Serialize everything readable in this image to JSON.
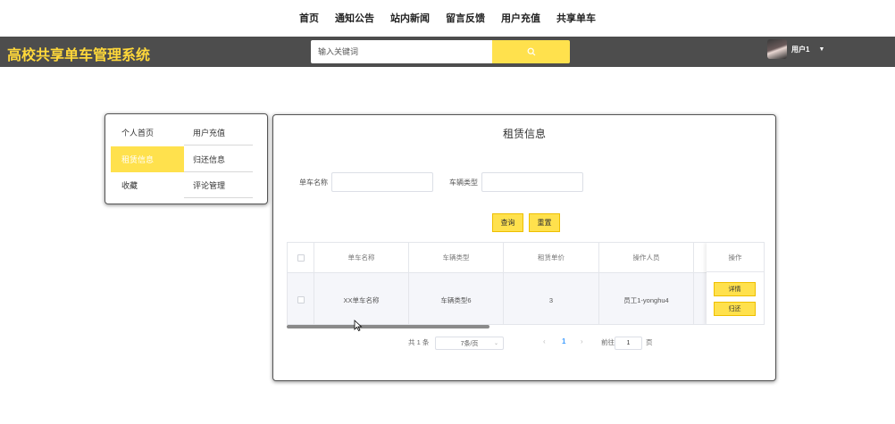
{
  "topnav": [
    "首页",
    "通知公告",
    "站内新闻",
    "留言反馈",
    "用户充值",
    "共享单车"
  ],
  "header": {
    "title": "高校共享单车管理系统",
    "search_placeholder": "输入关键词",
    "user_name": "用户1"
  },
  "sidebar": {
    "items": [
      {
        "label": "个人首页"
      },
      {
        "label": "用户充值"
      },
      {
        "label": "租赁信息",
        "active": true
      },
      {
        "label": "归还信息"
      },
      {
        "label": "收藏"
      },
      {
        "label": "评论管理"
      }
    ]
  },
  "main": {
    "title": "租赁信息",
    "filters": {
      "bike_name_label": "单车名称",
      "bike_name_value": "",
      "bike_type_label": "车辆类型",
      "bike_type_value": ""
    },
    "buttons": {
      "query": "查询",
      "reset": "重置"
    },
    "table": {
      "columns": [
        "单车名称",
        "车辆类型",
        "租赁单价",
        "操作人员"
      ],
      "op_header": "操作",
      "rows": [
        {
          "name": "XX单车名称",
          "type": "车辆类型6",
          "price": "3",
          "operator": "员工1-yonghu4",
          "actions": [
            "详情",
            "归还"
          ]
        }
      ]
    },
    "pagination": {
      "total": "共 1 条",
      "page_size": "7条/页",
      "current_page": "1",
      "goto_label": "前往",
      "goto_value": "1",
      "page_suffix": "页"
    }
  }
}
